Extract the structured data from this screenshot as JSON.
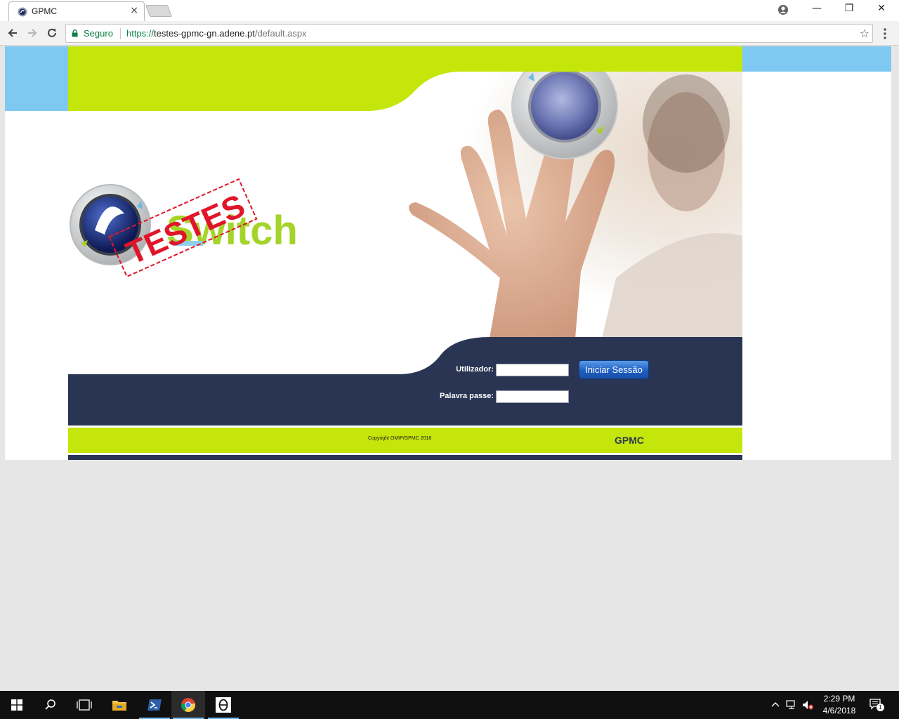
{
  "browser": {
    "tab_title": "GPMC",
    "tab_close": "×",
    "secure_label": "Seguro",
    "url_scheme": "https://",
    "url_host": "testes-gpmc-gn.adene.pt",
    "url_path": "/default.aspx",
    "bookmark_star": "☆",
    "window_minimize": "—",
    "window_restore": "❐",
    "window_close": "✕"
  },
  "page": {
    "brand_word": "Switch",
    "stamp_text": "TESTES",
    "username_label": "Utilizador:",
    "password_label": "Palavra passe:",
    "login_button": "Iniciar Sessão",
    "copyright": "Copyright OMIP/GPMC 2018",
    "footer_brand": "GPMC",
    "colors": {
      "lime": "#c4e60a",
      "navy": "#293552",
      "sky": "#7ec8f2"
    }
  },
  "taskbar": {
    "items": [
      "windows-start",
      "search",
      "task-view",
      "file-explorer",
      "powershell",
      "chrome",
      "theta-app"
    ],
    "clock_time": "2:29 PM",
    "clock_date": "4/6/2018",
    "notification_count": "1"
  }
}
